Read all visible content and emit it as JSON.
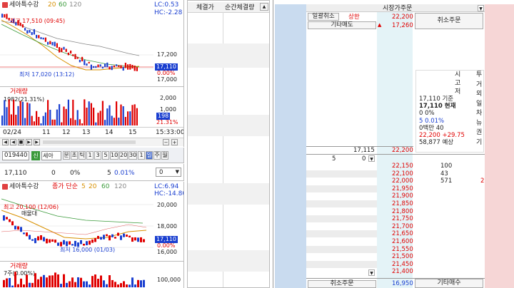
{
  "chart_top": {
    "title": "세아특수강",
    "ma_labels": [
      "20",
      "60",
      "120"
    ],
    "lc": "LC:0.53",
    "hc": "HC:-2.28",
    "high_label": "최고 17,510 (09:45)",
    "low_label": "최저 17,020 (13:12)",
    "price_ticks": [
      "17,200",
      "17,000"
    ],
    "price_tag": "17,110",
    "pct_tag": "0.00%",
    "volume_title": "거래량",
    "volume_info": "1982(21.31%)",
    "vol_ticks": [
      "2,000",
      "1,000"
    ],
    "vol_tag": "198",
    "vol_pct": "21.31%",
    "x_labels": [
      "02/24",
      "11",
      "12",
      "13",
      "14",
      "15"
    ],
    "time": "15:33:00"
  },
  "toolbar": {
    "code": "019440",
    "badge": "신",
    "name": "세아",
    "buttons": [
      "분",
      "초",
      "틱",
      "1",
      "3",
      "5",
      "10",
      "20",
      "30",
      "1",
      "일",
      "주",
      "월"
    ]
  },
  "quote_row": {
    "price": "17,110",
    "change": "0",
    "pct": "0%",
    "qty": "5",
    "rate": "0.01%",
    "dropdown": "0"
  },
  "chart_bottom": {
    "title": "세아특수강",
    "labels": [
      "종가 단순",
      "5",
      "20",
      "60",
      "120"
    ],
    "lc": "LC:6.94",
    "hc": "HC:-14.80",
    "high_label": "최고 20,100 (12/06)",
    "sub_label": "매물대",
    "low_label": "최저 16,000 (01/03)",
    "price_ticks": [
      "20,000",
      "18,000",
      "16,000"
    ],
    "price_tag": "17,110",
    "pct_tag": "0.00%",
    "volume_title": "거래량",
    "volume_info": "7주(0.00%)",
    "vol_tick": "100,000"
  },
  "trades": {
    "col1": "체결가",
    "col2": "순간체결량"
  },
  "orderbook": {
    "title": "시장가주문",
    "cancel_all": "일괄취소",
    "upper_limit_label": "상한",
    "upper_limit": "22,200",
    "other_sell": "기타매도",
    "other_sell_price": "17,260",
    "cancel_order": "취소주문",
    "side_labels": [
      "투",
      "거",
      "외",
      "일",
      "차",
      "뉴",
      "권",
      "기"
    ],
    "info_vertical": [
      "시",
      "고",
      "저"
    ],
    "info_lines": [
      {
        "label": "17,110 기준",
        "bold": false
      },
      {
        "label": "17,110 현재",
        "bold": true
      },
      {
        "label": "0 0%",
        "bold": false
      },
      {
        "label": "5 0.01%",
        "bold": false
      },
      {
        "label": "0백만 40",
        "bold": false
      },
      {
        "label": "22,200 +29.75",
        "bold": false
      },
      {
        "label": "58,877 예상",
        "bold": false
      }
    ],
    "ask_total": "17,115",
    "first_bid_price": "22,200",
    "bid_left_qty": "5",
    "bid_left_qty2": "0",
    "rows": [
      {
        "price": "22,150",
        "qty": "100",
        "right": ""
      },
      {
        "price": "22,100",
        "qty": "43",
        "right": ""
      },
      {
        "price": "22,000",
        "qty": "571",
        "right": "2"
      },
      {
        "price": "21,950",
        "qty": "",
        "right": ""
      },
      {
        "price": "21,900",
        "qty": "",
        "right": ""
      },
      {
        "price": "21,850",
        "qty": "",
        "right": ""
      },
      {
        "price": "21,800",
        "qty": "",
        "right": ""
      },
      {
        "price": "21,750",
        "qty": "",
        "right": ""
      },
      {
        "price": "21,700",
        "qty": "",
        "right": ""
      },
      {
        "price": "21,650",
        "qty": "",
        "right": ""
      },
      {
        "price": "21,600",
        "qty": "",
        "right": ""
      },
      {
        "price": "21,550",
        "qty": "",
        "right": ""
      },
      {
        "price": "21,500",
        "qty": "",
        "right": ""
      },
      {
        "price": "21,450",
        "qty": "",
        "right": ""
      },
      {
        "price": "21,400",
        "qty": "",
        "right": ""
      }
    ],
    "bottom_cancel": "취소주문",
    "bottom_price": "16,950",
    "other_buy": "기타매수"
  },
  "colors": {
    "up": "#e00000",
    "down": "#1a3fd0",
    "ob_blue_col": "#c9dbef",
    "ob_pink_col": "#f6d6d6",
    "price_col": "#e4f3f7"
  }
}
